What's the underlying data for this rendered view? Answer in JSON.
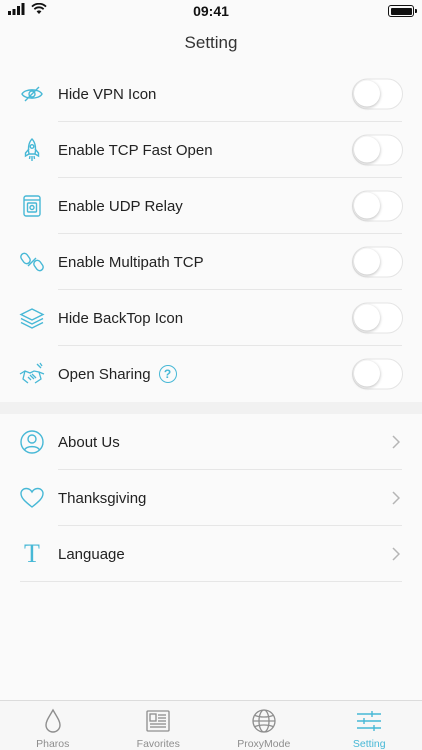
{
  "status_bar": {
    "time": "09:41"
  },
  "nav": {
    "title": "Setting"
  },
  "colors": {
    "accent": "#47b8d6",
    "text": "#222222",
    "divider": "#e6e6e6",
    "inactive_tab": "#8e8e8e"
  },
  "toggles": [
    {
      "label": "Hide VPN Icon",
      "icon": "eye-slash-icon",
      "on": false
    },
    {
      "label": "Enable TCP Fast Open",
      "icon": "rocket-icon",
      "on": false
    },
    {
      "label": "Enable UDP Relay",
      "icon": "device-icon",
      "on": false
    },
    {
      "label": "Enable Multipath TCP",
      "icon": "link-icon",
      "on": false
    },
    {
      "label": "Hide BackTop Icon",
      "icon": "layers-icon",
      "on": false
    },
    {
      "label": "Open Sharing",
      "icon": "handshake-icon",
      "on": false,
      "help": "?"
    }
  ],
  "links": [
    {
      "label": "About Us",
      "icon": "person-icon"
    },
    {
      "label": "Thanksgiving",
      "icon": "heart-icon"
    },
    {
      "label": "Language",
      "icon": "letter-t-icon",
      "icon_text": "T"
    }
  ],
  "tabs": [
    {
      "label": "Pharos",
      "icon": "drop-icon",
      "active": false
    },
    {
      "label": "Favorites",
      "icon": "document-icon",
      "active": false
    },
    {
      "label": "ProxyMode",
      "icon": "globe-icon",
      "active": false
    },
    {
      "label": "Setting",
      "icon": "sliders-icon",
      "active": true
    }
  ]
}
